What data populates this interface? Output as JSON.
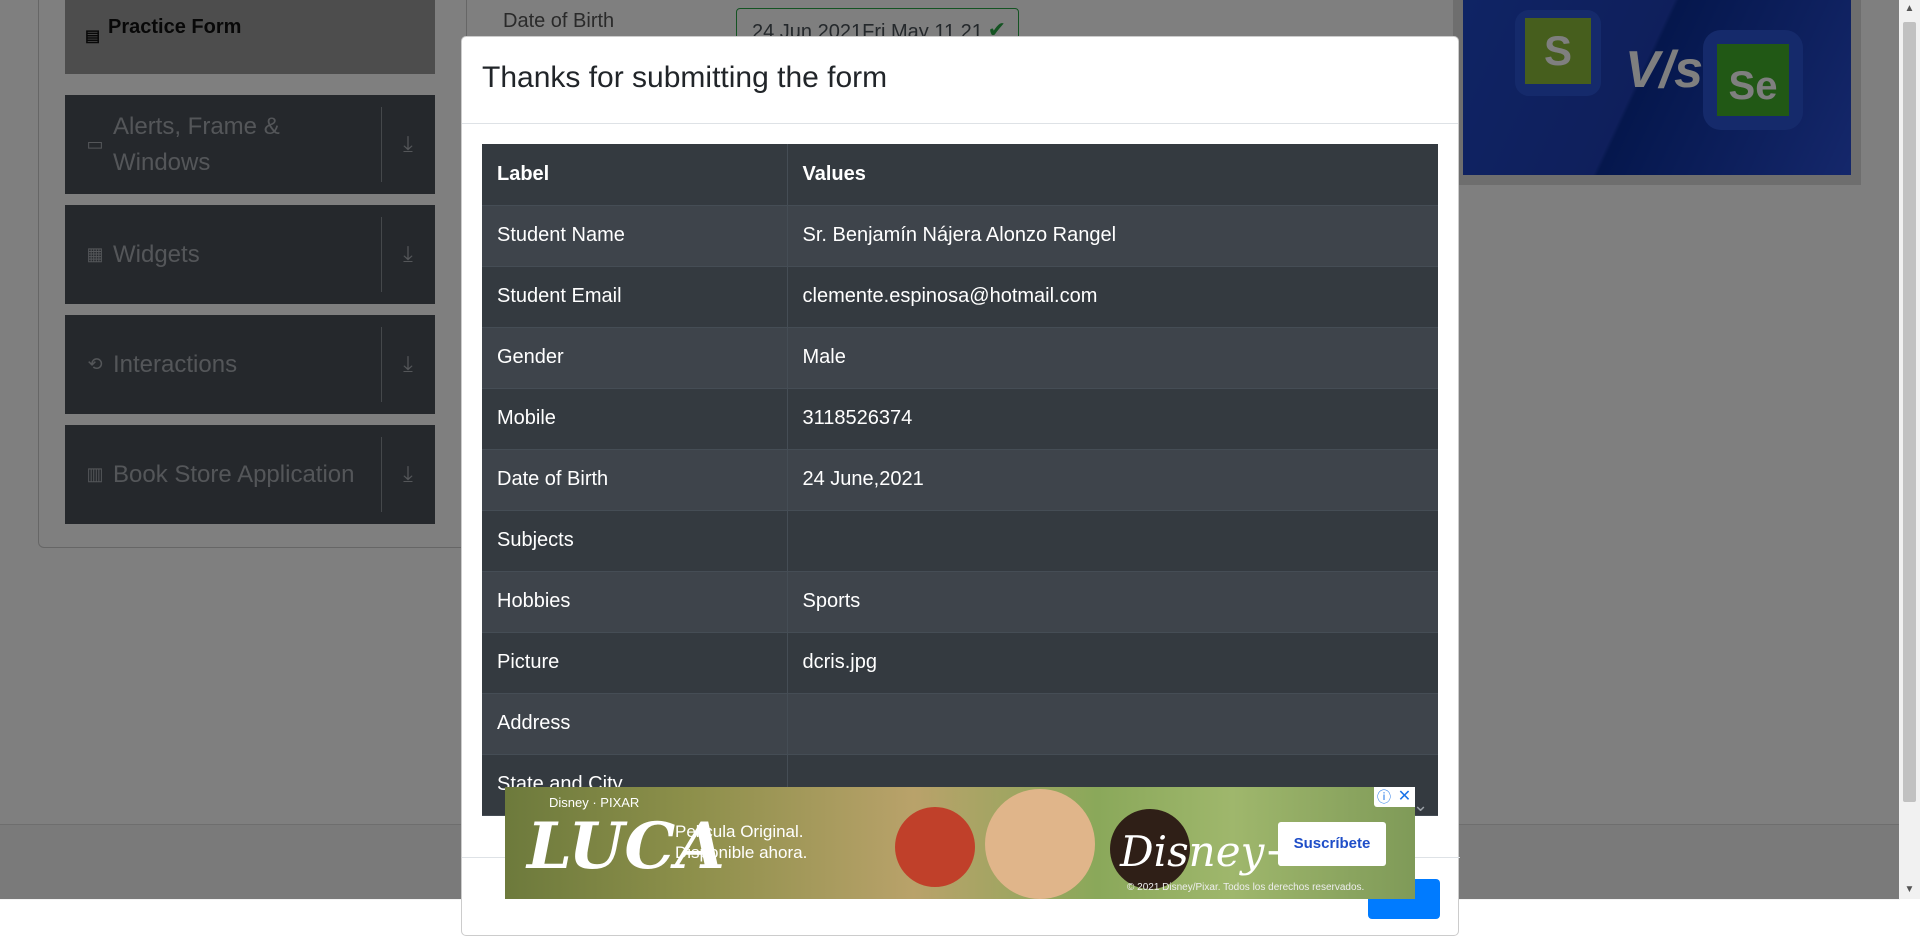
{
  "sidebar": {
    "practice_form": "Practice Form",
    "groups": [
      {
        "label": "Alerts, Frame & Windows",
        "icon": "window-icon"
      },
      {
        "label": "Widgets",
        "icon": "widgets-icon"
      },
      {
        "label": "Interactions",
        "icon": "interactions-icon"
      },
      {
        "label": "Book Store Application",
        "icon": "books-icon"
      }
    ]
  },
  "background_form": {
    "dob_label": "Date of Birth",
    "dob_value": "24 Jun 2021Fri May 11 21"
  },
  "banner": {
    "left_logo": "S",
    "vs": "V/s",
    "right_logo": "Se"
  },
  "modal": {
    "title": "Thanks for submitting the form",
    "table": {
      "headers": [
        "Label",
        "Values"
      ],
      "rows": [
        [
          "Student Name",
          "Sr. Benjamín Nájera Alonzo Rangel"
        ],
        [
          "Student Email",
          "clemente.espinosa@hotmail.com"
        ],
        [
          "Gender",
          "Male"
        ],
        [
          "Mobile",
          "3118526374"
        ],
        [
          "Date of Birth",
          "24 June,2021"
        ],
        [
          "Subjects",
          ""
        ],
        [
          "Hobbies",
          "Sports"
        ],
        [
          "Picture",
          "dcris.jpg"
        ],
        [
          "Address",
          ""
        ],
        [
          "State and City",
          ""
        ]
      ]
    }
  },
  "ad": {
    "brand_top": "Disney · PIXAR",
    "title": "LUCA",
    "tagline_1": "Película Original.",
    "tagline_2": "Disponible ahora.",
    "disney_logo": "Disney+",
    "cta": "Suscríbete",
    "copyright": "© 2021 Disney/Pixar. Todos los derechos reservados."
  },
  "colors": {
    "table_dark": "#343a40",
    "table_stripe": "#3e444b",
    "primary": "#007bff",
    "success": "#28a745"
  }
}
